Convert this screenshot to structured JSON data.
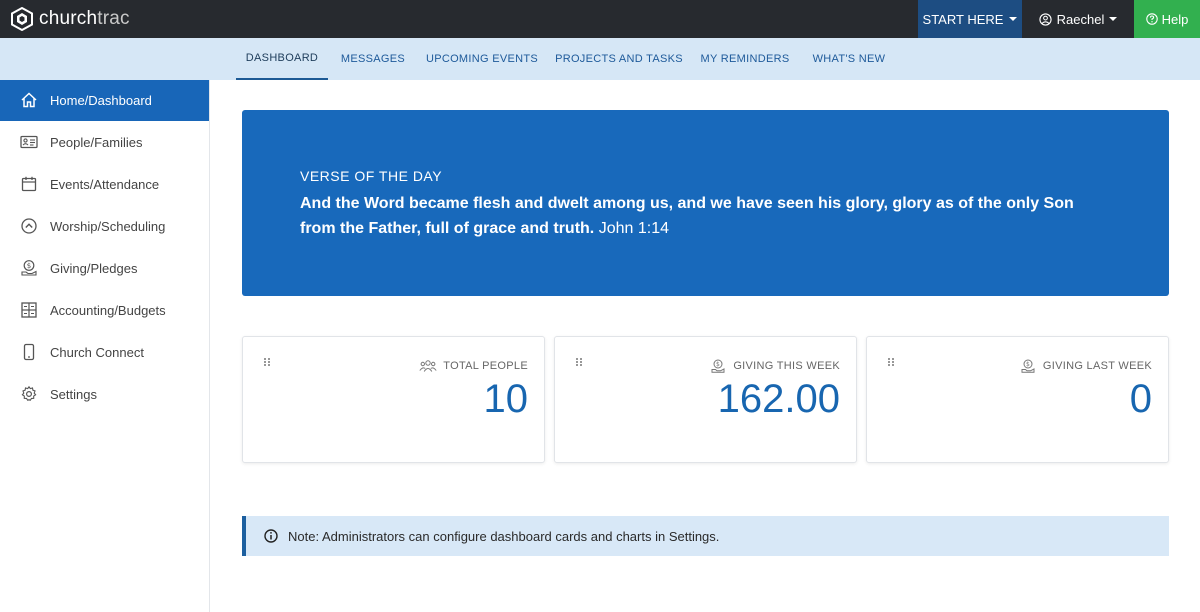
{
  "brand": {
    "name_bold": "church",
    "name_light": "trac"
  },
  "topbar": {
    "start_here": "START HERE",
    "user_name": "Raechel",
    "help": "Help"
  },
  "tabs": [
    {
      "label": "DASHBOARD",
      "active": true
    },
    {
      "label": "MESSAGES"
    },
    {
      "label": "UPCOMING EVENTS"
    },
    {
      "label": "PROJECTS AND TASKS"
    },
    {
      "label": "MY REMINDERS"
    },
    {
      "label": "WHAT'S NEW"
    }
  ],
  "sidebar": {
    "items": [
      {
        "label": "Home/Dashboard",
        "icon": "home-icon",
        "active": true
      },
      {
        "label": "People/Families",
        "icon": "id-card-icon"
      },
      {
        "label": "Events/Attendance",
        "icon": "calendar-icon"
      },
      {
        "label": "Worship/Scheduling",
        "icon": "chevron-circle-icon"
      },
      {
        "label": "Giving/Pledges",
        "icon": "money-hand-icon"
      },
      {
        "label": "Accounting/Budgets",
        "icon": "grid-icon"
      },
      {
        "label": "Church Connect",
        "icon": "phone-icon"
      },
      {
        "label": "Settings",
        "icon": "gear-icon"
      }
    ]
  },
  "verse": {
    "label": "VERSE OF THE DAY",
    "text": "And the Word became flesh and dwelt among us, and we have seen his glory, glory as of the only Son from the Father, full of grace and truth.",
    "reference": "John 1:14"
  },
  "cards": [
    {
      "title": "TOTAL PEOPLE",
      "value": "10",
      "icon": "people-icon"
    },
    {
      "title": "GIVING THIS WEEK",
      "value": "162.00",
      "icon": "money-hand-icon"
    },
    {
      "title": "GIVING LAST WEEK",
      "value": "0",
      "icon": "money-hand-icon"
    }
  ],
  "note": {
    "text": "Note: Administrators can configure dashboard cards and charts in Settings."
  },
  "colors": {
    "topbar": "#272a2f",
    "start_here": "#1d4d82",
    "help": "#32b04f",
    "primary": "#1866b8",
    "tabs_bg": "#d6e7f6"
  }
}
